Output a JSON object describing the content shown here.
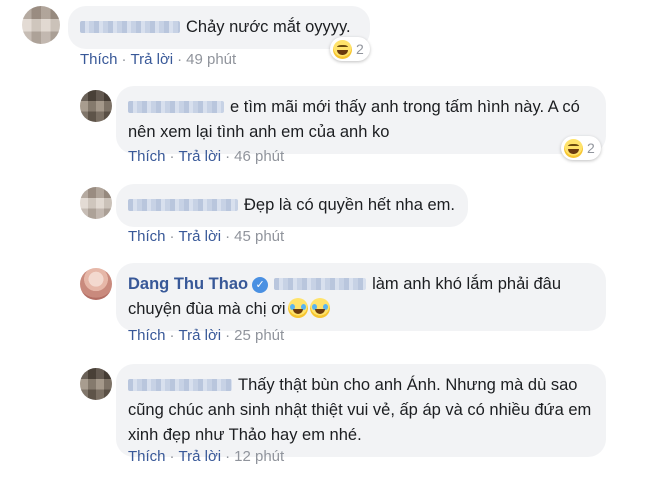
{
  "actions": {
    "like": "Thích",
    "reply": "Trả lời",
    "separator": "·"
  },
  "comments": [
    {
      "text": "Chảy nước mắt oyyyy.",
      "time": "49 phút",
      "reaction_count": "2"
    },
    {
      "text": "e tìm mãi mới thấy anh trong tấm hình này. A có nên xem lại tình anh em của anh ko",
      "time": "46 phút",
      "reaction_count": "2"
    },
    {
      "text": "Đẹp là có quyền hết nha em.",
      "time": "45 phút"
    },
    {
      "author": "Dang Thu Thao",
      "verified_icon": "verified-check-icon",
      "text": "làm anh khó lắm phải đâu chuyện đùa mà chị ơi",
      "time": "25 phút"
    },
    {
      "text": "Thấy thật bùn cho anh Ánh. Nhưng mà dù sao cũng chúc anh sinh nhật thiệt vui vẻ, ấp áp và có nhiều đứa em xinh đẹp như Thảo hay em nhé.",
      "time": "12 phút"
    }
  ],
  "colors": {
    "link": "#385898",
    "bubble": "#f2f3f5",
    "meta": "#90949c"
  }
}
